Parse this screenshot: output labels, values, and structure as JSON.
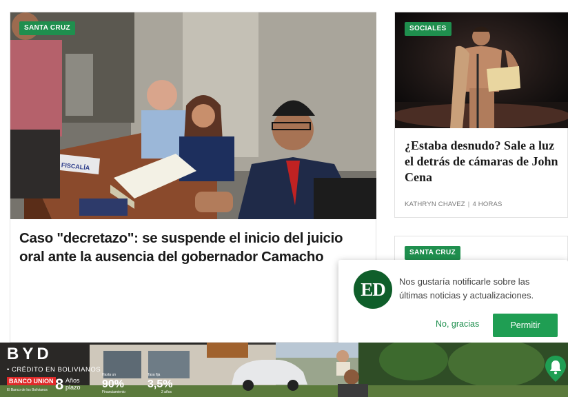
{
  "main_article": {
    "category": "SANTA CRUZ",
    "title": "Caso \"decretazo\": se suspende el inicio del juicio oral ante la ausencia del gobernador Camacho",
    "sign_text": "FISCALÍA"
  },
  "side_article": {
    "category": "SOCIALES",
    "title": "¿Estaba desnudo? Sale a luz el detrás de cámaras de John Cena",
    "author": "KATHRYN CHAVEZ",
    "separator": "|",
    "time": "4 HORAS"
  },
  "side_article_2": {
    "category": "SANTA CRUZ"
  },
  "notification": {
    "logo_text": "ED",
    "message": "Nos gustaría notificarle sobre las últimas noticias y actualizaciones.",
    "decline_label": "No, gracias",
    "accept_label": "Permitir"
  },
  "ad_banner": {
    "brand": "BYD",
    "credit_text": "• CRÉDITO EN BOLIVIANOS",
    "bank_name": "BANCO UNION",
    "bank_sub": "El Banco de los Bolivianos",
    "years_value": "8",
    "years_label_1": "Años",
    "years_label_2": "plazo",
    "finance_top": "Hasta un",
    "finance_value": "90%",
    "finance_label": "Financiamiento",
    "rate_top": "Tasa fija",
    "rate_value": "3,5%",
    "rate_label": "2 años"
  },
  "colors": {
    "accent_green": "#1f8f4e",
    "button_green": "#1f9e53",
    "logo_green": "#0f5e2a"
  },
  "icons": [
    "bell-icon"
  ]
}
